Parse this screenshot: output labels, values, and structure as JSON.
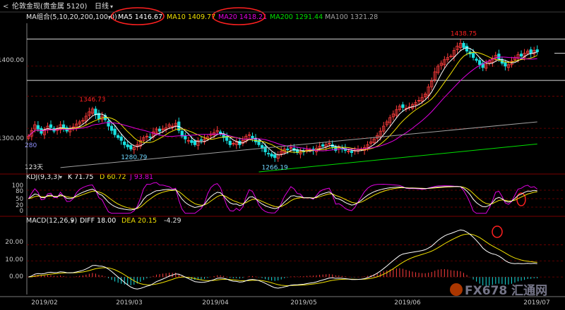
{
  "header": {
    "title": "伦敦金现(贵金属 5120)",
    "period": "日线",
    "back_glyph": "<"
  },
  "colors": {
    "up": "#ff3c3c",
    "down": "#19e0e0",
    "ma5": "#ffffff",
    "ma10": "#f0e000",
    "ma20": "#e000e0",
    "ma200": "#00e000",
    "ma100": "#a0a0a0",
    "grid": "#7a0000",
    "axis": "#a0a0a0",
    "text": "#c8c8c8",
    "annot": "#ff2020",
    "divider": "#7a0000"
  },
  "ma_legend": {
    "label": "MA组合(5,10,20,200,100,0)",
    "items": [
      {
        "name": "MA5",
        "value": "1416.67"
      },
      {
        "name": "MA10",
        "value": "1409.77"
      },
      {
        "name": "MA20",
        "value": "1418.21"
      },
      {
        "name": "MA200",
        "value": "1291.44"
      },
      {
        "name": "MA100",
        "value": "1321.28"
      }
    ]
  },
  "kdj_legend": {
    "label": "KDJ(9,3,3)",
    "items": [
      {
        "name": "K",
        "value": "71.75"
      },
      {
        "name": "D",
        "value": "60.72"
      },
      {
        "name": "J",
        "value": "93.81"
      }
    ]
  },
  "macd_legend": {
    "label": "MACD(12,26,9)",
    "items": [
      {
        "name": "DIFF",
        "value": "18.00"
      },
      {
        "name": "DEA",
        "value": "20.15"
      },
      {
        "name": "",
        "value": "-4.29"
      }
    ]
  },
  "watermark": "FX678 汇通网",
  "chart_data": [
    {
      "type": "candlestick",
      "panel": "price",
      "y_ticks": [
        "1400.00",
        "1300.00"
      ],
      "ylim": [
        1250,
        1460
      ],
      "x_ticks": [
        "2019/02",
        "2019/03",
        "2019/04",
        "2019/05",
        "2019/06",
        "2019/07"
      ],
      "annotations": [
        {
          "label": "1346.73",
          "kind": "high",
          "index": 20
        },
        {
          "label": "1280.79",
          "kind": "low",
          "index": 33
        },
        {
          "label": "1266.19",
          "kind": "low",
          "index": 77
        },
        {
          "label": "1438.75",
          "kind": "high",
          "index": 136
        }
      ],
      "left_labels": [
        {
          "text": "280"
        },
        {
          "text": "123天"
        }
      ],
      "horizontal_lines": [
        1438,
        1380
      ],
      "closes": [
        1302,
        1310,
        1318,
        1312,
        1306,
        1311,
        1316,
        1314,
        1309,
        1313,
        1318,
        1312,
        1309,
        1313,
        1315,
        1319,
        1322,
        1324,
        1330,
        1336,
        1340,
        1332,
        1326,
        1330,
        1325,
        1316,
        1310,
        1304,
        1300,
        1296,
        1290,
        1287,
        1284,
        1286,
        1290,
        1296,
        1300,
        1302,
        1300,
        1308,
        1312,
        1309,
        1312,
        1314,
        1318,
        1316,
        1320,
        1310,
        1302,
        1298,
        1296,
        1293,
        1290,
        1296,
        1296,
        1298,
        1301,
        1305,
        1307,
        1310,
        1305,
        1300,
        1296,
        1290,
        1292,
        1295,
        1290,
        1296,
        1302,
        1304,
        1299,
        1294,
        1290,
        1286,
        1280,
        1277,
        1274,
        1272,
        1276,
        1281,
        1284,
        1283,
        1286,
        1282,
        1279,
        1281,
        1280,
        1283,
        1283,
        1282,
        1285,
        1288,
        1288,
        1290,
        1292,
        1287,
        1282,
        1286,
        1284,
        1282,
        1281,
        1279,
        1282,
        1283,
        1284,
        1286,
        1290,
        1294,
        1298,
        1303,
        1309,
        1316,
        1322,
        1328,
        1333,
        1339,
        1344,
        1342,
        1341,
        1343,
        1346,
        1349,
        1352,
        1356,
        1361,
        1371,
        1379,
        1392,
        1400,
        1404,
        1409,
        1412,
        1414,
        1422,
        1428,
        1432,
        1426,
        1421,
        1417,
        1412,
        1408,
        1402,
        1398,
        1403,
        1407,
        1411,
        1415,
        1410,
        1404,
        1400,
        1402,
        1407,
        1412,
        1416,
        1414,
        1418,
        1421,
        1418,
        1422,
        1420
      ]
    },
    {
      "type": "line",
      "panel": "kdj",
      "y_ticks": [
        "100",
        "80",
        "50",
        "20",
        "0"
      ],
      "ylim": [
        -5,
        110
      ],
      "series": [
        {
          "name": "K",
          "color_key": "ma5"
        },
        {
          "name": "D",
          "color_key": "ma10"
        },
        {
          "name": "J",
          "color_key": "ma20"
        }
      ]
    },
    {
      "type": "bar+line",
      "panel": "macd",
      "y_ticks": [
        "20.00",
        "10.00",
        "0.00"
      ],
      "ylim": [
        -10,
        32
      ],
      "series": [
        {
          "name": "DIFF",
          "color_key": "ma5"
        },
        {
          "name": "DEA",
          "color_key": "ma10"
        }
      ]
    }
  ]
}
